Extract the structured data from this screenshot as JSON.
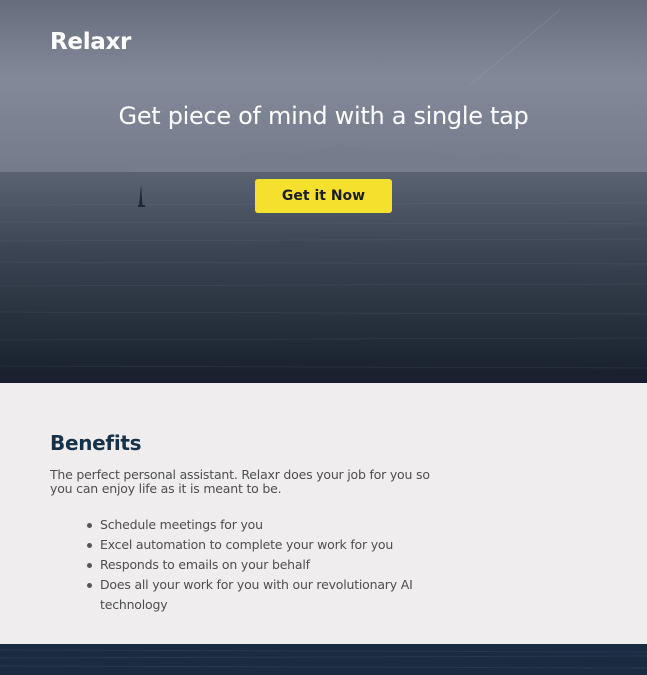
{
  "brand": {
    "name": "Relaxr"
  },
  "hero": {
    "headline": "Get piece of mind with a single tap",
    "cta_label": "Get it Now"
  },
  "benefits": {
    "title": "Benefits",
    "intro": "The perfect personal assistant. Relaxr does your job for you so you can enjoy life as it is meant to be.",
    "items": [
      "Schedule meetings for you",
      "Excel automation to complete your work for you",
      "Responds to emails on your behalf",
      "Does all your work for you with our revolutionary AI technology"
    ]
  },
  "colors": {
    "cta_background": "#f5e12d",
    "heading": "#16324a",
    "section_background": "#efedee",
    "footer": "#1c2a3e"
  }
}
